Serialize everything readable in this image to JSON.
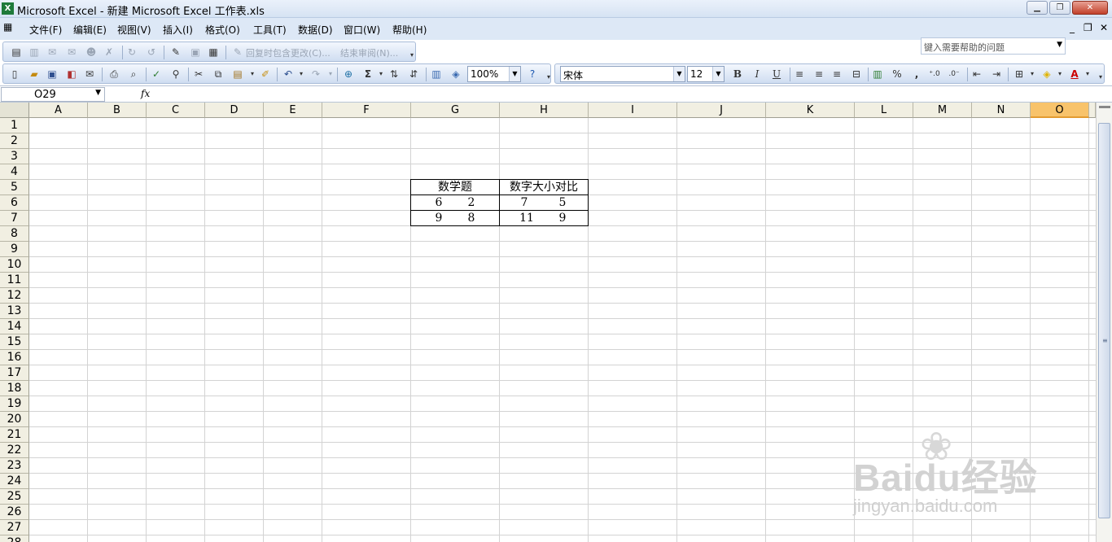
{
  "window": {
    "title": "Microsoft Excel - 新建 Microsoft Excel 工作表.xls",
    "app_icon": "excel-icon",
    "controls": [
      "minimize",
      "restore",
      "close"
    ]
  },
  "menu": {
    "items": [
      "文件(F)",
      "编辑(E)",
      "视图(V)",
      "插入(I)",
      "格式(O)",
      "工具(T)",
      "数据(D)",
      "窗口(W)",
      "帮助(H)"
    ],
    "help_placeholder": "键入需要帮助的问题"
  },
  "review_toolbar": {
    "reply_label": "回复时包含更改(C)...",
    "end_review_label": "结束审阅(N)..."
  },
  "standard_toolbar": {
    "zoom": "100%"
  },
  "format_toolbar": {
    "font": "宋体",
    "size": "12",
    "bold": "B",
    "italic": "I",
    "underline": "U",
    "percent": "%",
    "comma": ","
  },
  "formula_bar": {
    "name_box": "O29",
    "fx": "fx",
    "content": ""
  },
  "sheet": {
    "columns": [
      "A",
      "B",
      "C",
      "D",
      "E",
      "F",
      "G",
      "H",
      "I",
      "J",
      "K",
      "L",
      "M",
      "N",
      "O"
    ],
    "selected_column": "O",
    "rows": [
      "1",
      "2",
      "3",
      "4",
      "5",
      "6",
      "7",
      "8",
      "9",
      "10",
      "11",
      "12",
      "13",
      "14",
      "15",
      "16",
      "17",
      "18",
      "19",
      "20",
      "21",
      "22",
      "23",
      "24",
      "25",
      "26",
      "27",
      "28"
    ],
    "cells": {
      "G5": "数学题",
      "H5": "数字大小对比",
      "G6a": "6",
      "G6b": "2",
      "H6a": "7",
      "H6b": "5",
      "G7a": "9",
      "G7b": "8",
      "H7a": "11",
      "H7b": "9"
    }
  },
  "watermark": {
    "brand": "Baidu经验",
    "site": "jingyan.baidu.com"
  }
}
